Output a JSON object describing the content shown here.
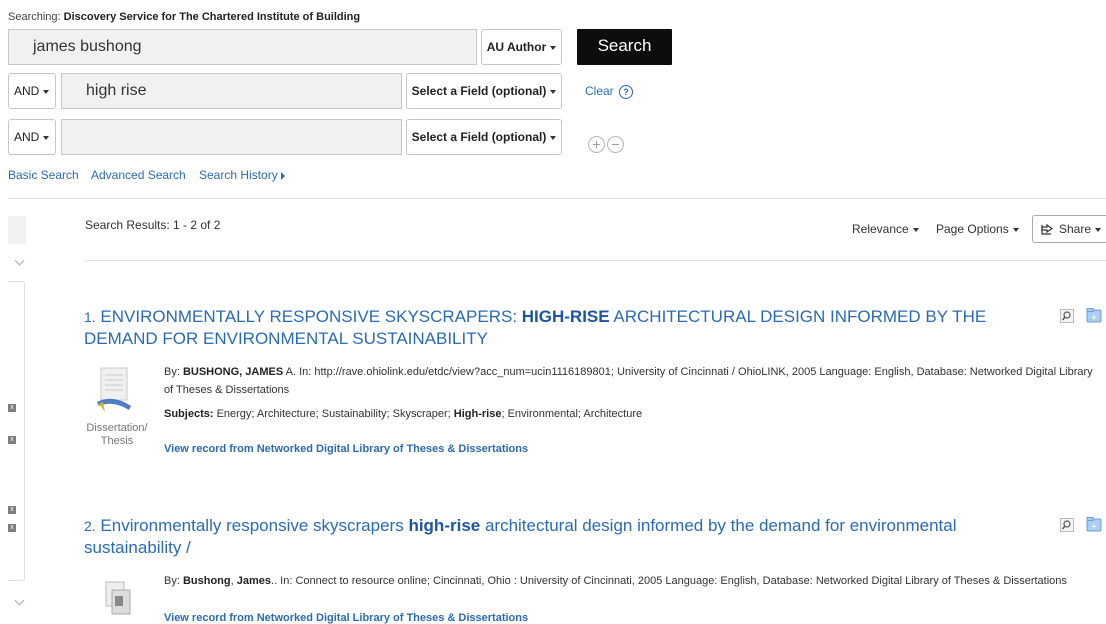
{
  "header": {
    "searching_label": "Searching:",
    "searching_target": "Discovery Service for The Chartered Institute of Building"
  },
  "search": {
    "row1": {
      "value": "james bushong",
      "field": "AU Author"
    },
    "row2": {
      "bool": "AND",
      "value": "high rise",
      "field": "Select a Field (optional)"
    },
    "row3": {
      "bool": "AND",
      "value": "",
      "field": "Select a Field (optional)"
    },
    "search_button": "Search",
    "clear_label": "Clear",
    "help_glyph": "?",
    "add_glyph": "+",
    "remove_glyph": "−"
  },
  "links": {
    "basic": "Basic Search",
    "advanced": "Advanced Search",
    "history": "Search History"
  },
  "results_bar": {
    "summary": "Search Results: 1 - 2 of 2",
    "sort": "Relevance",
    "page_options": "Page Options",
    "share": "Share"
  },
  "results": [
    {
      "number": "1.",
      "title_pre": "ENVIRONMENTALLY RESPONSIVE SKYSCRAPERS: ",
      "title_hl": "HIGH-RISE",
      "title_post": " ARCHITECTURAL DESIGN INFORMED BY THE DEMAND FOR ENVIRONMENTAL SUSTAINABILITY",
      "by_label": "By: ",
      "author_hl": "BUSHONG, JAMES",
      "author_rest": " A. In: http://rave.ohiolink.edu/etdc/view?acc_num=ucin1116189801; University of Cincinnati / OhioLINK, 2005 Language: English, Database: Networked Digital Library of Theses & Dissertations",
      "subjects_label": "Subjects:",
      "subjects_pre": " Energy; Architecture; Sustainability; Skyscraper; ",
      "subjects_hl": "High-rise",
      "subjects_post": "; Environmental; Architecture",
      "doc_type": "Dissertation/ Thesis",
      "view_link": "View record from Networked Digital Library of Theses & Dissertations"
    },
    {
      "number": "2.",
      "title_pre": "Environmentally responsive skyscrapers ",
      "title_hl": "high-rise",
      "title_post": " architectural design informed by the demand for environmental sustainability /",
      "by_label": "By: ",
      "author_hl1": "Bushong",
      "author_sep": ", ",
      "author_hl2": "James",
      "author_rest": ".. In: Connect to resource online; Cincinnati, Ohio : University of Cincinnati, 2005 Language: English, Database: Networked Digital Library of Theses & Dissertations",
      "view_link": "View record from Networked Digital Library of Theses & Dissertations"
    }
  ],
  "colors": {
    "link": "#2a6ab8",
    "search_button": "#0d0d0d",
    "input_bg": "#f1f1f1"
  }
}
